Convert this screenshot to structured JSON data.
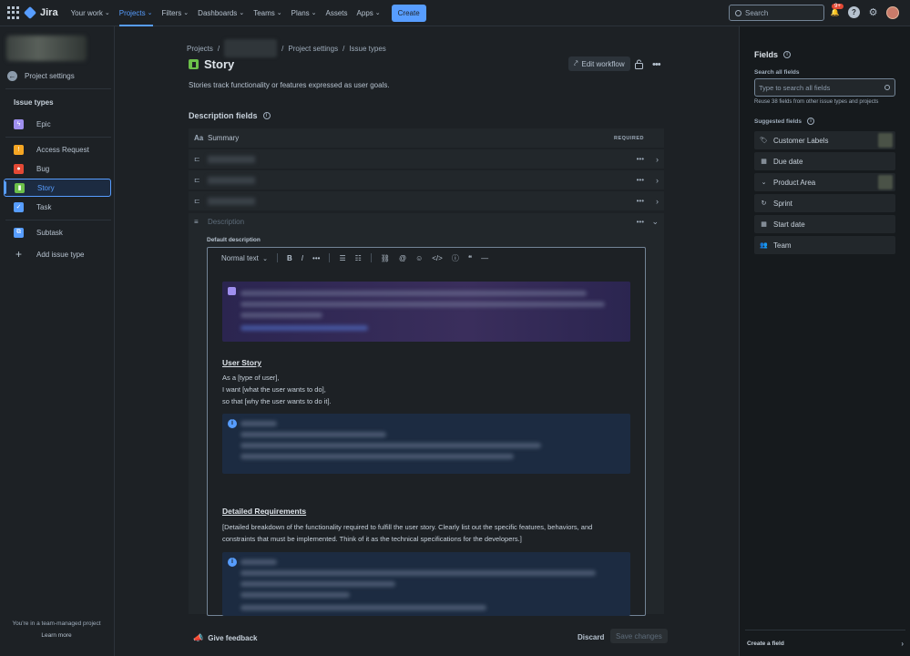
{
  "topbar": {
    "app_name": "Jira",
    "nav": [
      "Your work",
      "Projects",
      "Filters",
      "Dashboards",
      "Teams",
      "Plans",
      "Assets",
      "Apps"
    ],
    "create_label": "Create",
    "search_placeholder": "Search",
    "notification_count": "9+"
  },
  "sidebar": {
    "back_label": "Project settings",
    "heading": "Issue types",
    "items": [
      {
        "label": "Epic",
        "color": "#9f8fef"
      },
      {
        "label": "Access Request",
        "color": "#f5a623"
      },
      {
        "label": "Bug",
        "color": "#e34935"
      },
      {
        "label": "Story",
        "color": "#6cc04a"
      },
      {
        "label": "Task",
        "color": "#579dff"
      },
      {
        "label": "Subtask",
        "color": "#579dff"
      }
    ],
    "add_label": "Add issue type",
    "footer_text": "You're in a team-managed project",
    "learn_more": "Learn more"
  },
  "main": {
    "breadcrumbs": [
      "Projects",
      "Project settings",
      "Issue types"
    ],
    "title": "Story",
    "edit_workflow": "Edit workflow",
    "description": "Stories track functionality or features expressed as user goals.",
    "section_title": "Description fields",
    "summary_label": "Summary",
    "required_label": "REQUIRED",
    "description_field_label": "Description",
    "default_description_label": "Default description",
    "editor_style": "Normal text",
    "doc": {
      "h1": "User Story",
      "p1": [
        "As a [type of user],",
        "I want [what the user wants to do],",
        "so that [why the user wants to do it]."
      ],
      "h2": "Detailed Requirements",
      "p2": [
        "[Detailed breakdown of the functionality required to fulfill the user story. Clearly list out the specific features, behaviors, and",
        "constraints that must be implemented. Think of it as the technical specifications for the developers.]"
      ]
    },
    "give_feedback": "Give feedback",
    "discard": "Discard",
    "save_changes": "Save changes"
  },
  "fields_panel": {
    "title": "Fields",
    "search_label": "Search all fields",
    "search_placeholder": "Type to search all fields",
    "hint": "Reuse 38 fields from other issue types and projects",
    "suggested_label": "Suggested fields",
    "suggested": [
      {
        "label": "Customer Labels",
        "icon": "tag-icon"
      },
      {
        "label": "Due date",
        "icon": "calendar-icon"
      },
      {
        "label": "Product Area",
        "icon": "dropdown-icon"
      },
      {
        "label": "Sprint",
        "icon": "sprint-icon"
      },
      {
        "label": "Start date",
        "icon": "calendar-icon"
      },
      {
        "label": "Team",
        "icon": "people-icon"
      }
    ],
    "create_field": "Create a field"
  }
}
